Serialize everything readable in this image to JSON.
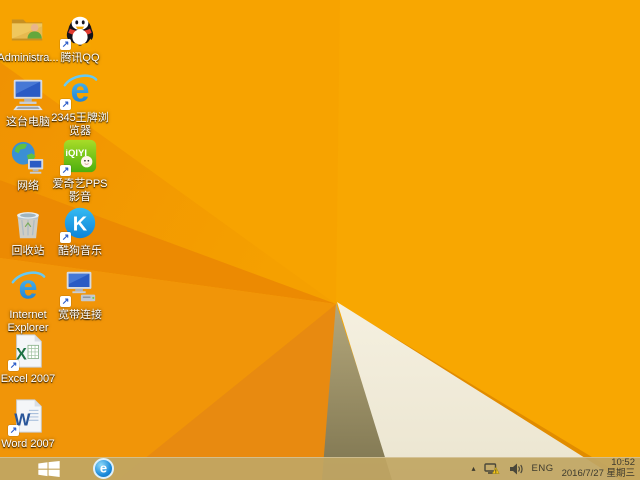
{
  "wallpaper": {
    "base_color": "#F8A701",
    "facet_colors": [
      "#F7A300",
      "#F39B00",
      "#EC8A02",
      "#F19508",
      "#E88A10"
    ],
    "cream_triangle_color": "#F2EDDB",
    "tan_triangle_color": "#9A8F64",
    "seam_color": "#E18C00"
  },
  "desktop": {
    "icons": [
      {
        "id": "administrator",
        "label": "Administra...",
        "icon": "user-folder-icon",
        "shortcut": false
      },
      {
        "id": "tencent-qq",
        "label": "腾讯QQ",
        "icon": "qq-penguin-icon",
        "shortcut": true
      },
      {
        "id": "this-pc",
        "label": "这台电脑",
        "icon": "computer-icon",
        "shortcut": false
      },
      {
        "id": "browser-2345",
        "label": "2345王牌浏览器",
        "icon": "ie-e-icon",
        "shortcut": true
      },
      {
        "id": "network",
        "label": "网络",
        "icon": "network-globe-icon",
        "shortcut": false
      },
      {
        "id": "iqiyi-pps",
        "label": "爱奇艺PPS 影音",
        "icon": "iqiyi-icon",
        "shortcut": true
      },
      {
        "id": "recycle-bin",
        "label": "回收站",
        "icon": "recycle-bin-icon",
        "shortcut": false
      },
      {
        "id": "kugou-music",
        "label": "酷狗音乐",
        "icon": "kugou-k-icon",
        "shortcut": true
      },
      {
        "id": "internet-explorer",
        "label": "Internet Explorer",
        "icon": "ie-e-icon",
        "shortcut": false
      },
      {
        "id": "broadband",
        "label": "宽带连接",
        "icon": "broadband-icon",
        "shortcut": true
      },
      {
        "id": "excel-2007",
        "label": "Excel 2007",
        "icon": "excel-icon",
        "shortcut": true
      },
      {
        "id": "word-2007",
        "label": "Word 2007",
        "icon": "word-icon",
        "shortcut": true
      }
    ]
  },
  "taskbar": {
    "start_icon": "windows-logo-icon",
    "pinned_icon": "ie-e-icon",
    "tray": {
      "hidden_icons_glyph": "▴",
      "icons": [
        "network-warning-icon",
        "volume-icon"
      ],
      "language": "ENG",
      "time": "10:52",
      "date": "2016/7/27 星期三"
    }
  }
}
